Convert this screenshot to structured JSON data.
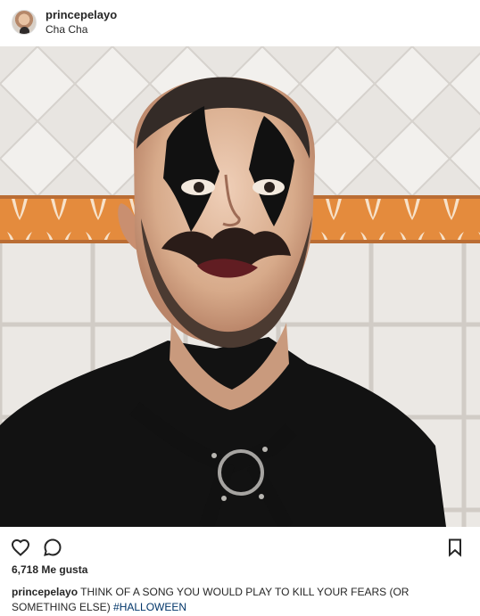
{
  "post": {
    "username": "princepelayo",
    "location": "Cha Cha"
  },
  "engagement": {
    "likes_label": "6,718 Me gusta"
  },
  "caption": {
    "username": "princepelayo",
    "text": "THINK OF A SONG YOU WOULD PLAY TO KILL YOUR FEARS (OR SOMETHING ELSE)",
    "hashtag": "#HALLOWEEN"
  },
  "icons": {
    "like": "heart-icon",
    "comment": "comment-icon",
    "save": "bookmark-icon",
    "avatar": "profile-avatar"
  },
  "colors": {
    "text": "#262626",
    "hashtag": "#003569",
    "background": "#ffffff"
  }
}
